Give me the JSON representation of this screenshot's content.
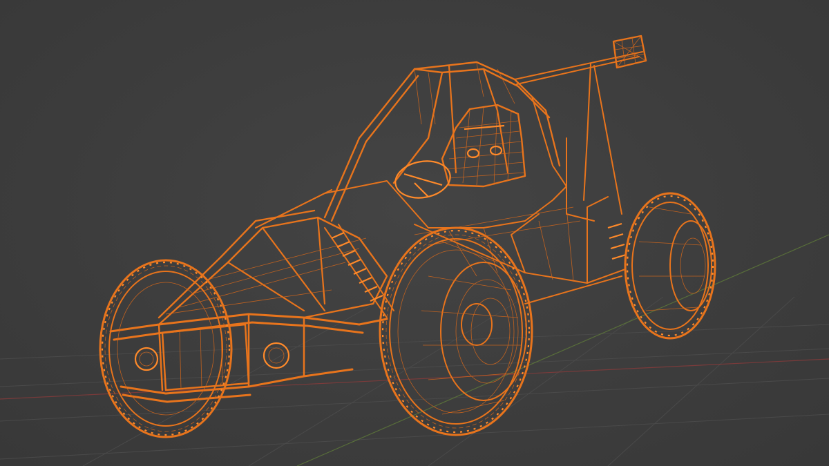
{
  "viewport": {
    "background": "#3d3d3d",
    "grid_color": "#4a4a4a",
    "axis_x_color": "#8a3b3b",
    "axis_y_color": "#5f7a3a"
  },
  "model": {
    "wire_color": "#e8741c",
    "wire_highlight": "#ff8a2a",
    "shading": "wireframe",
    "selected": true
  }
}
